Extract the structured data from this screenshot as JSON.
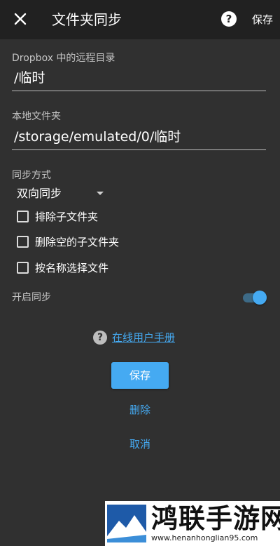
{
  "appbar": {
    "title": "文件夹同步",
    "help_glyph": "?",
    "save_label": "保存"
  },
  "remote": {
    "label": "Dropbox 中的远程目录",
    "value": "/临时"
  },
  "local": {
    "label": "本地文件夹",
    "value": "/storage/emulated/0/临时"
  },
  "sync_method": {
    "label": "同步方式",
    "value": "双向同步"
  },
  "options": [
    {
      "label": "排除子文件夹",
      "checked": false
    },
    {
      "label": "删除空的子文件夹",
      "checked": false
    },
    {
      "label": "按名称选择文件",
      "checked": false
    }
  ],
  "enable_sync": {
    "label": "开启同步",
    "on": true
  },
  "manual": {
    "icon_glyph": "?",
    "link_text": "在线用户手册"
  },
  "actions": {
    "save": "保存",
    "delete": "删除",
    "cancel": "取消"
  },
  "watermark": {
    "title": "鸿联手游网",
    "url": "www.henanhonglian95.com"
  },
  "colors": {
    "accent": "#45aaf2",
    "background": "#303030",
    "appbar": "#212121"
  }
}
